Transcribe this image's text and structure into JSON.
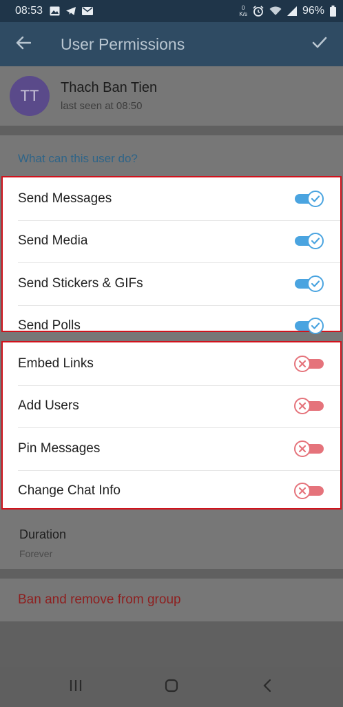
{
  "status_bar": {
    "time": "08:53",
    "net_speed_value": "0",
    "net_speed_unit": "K/s",
    "battery": "96%",
    "icons": [
      "gallery-icon",
      "telegram-icon",
      "mail-icon",
      "alarm-icon",
      "wifi-icon",
      "signal-icon",
      "battery-icon"
    ]
  },
  "app_bar": {
    "title": "User Permissions",
    "back_icon": "back-arrow-icon",
    "confirm_icon": "checkmark-icon"
  },
  "user": {
    "initials": "TT",
    "name": "Thach Ban Tien",
    "last_seen": "last seen at 08:50"
  },
  "permissions": {
    "header": "What can this user do?",
    "allowed": [
      {
        "label": "Send Messages",
        "enabled": true
      },
      {
        "label": "Send Media",
        "enabled": true
      },
      {
        "label": "Send Stickers & GIFs",
        "enabled": true
      },
      {
        "label": "Send Polls",
        "enabled": true
      }
    ],
    "denied": [
      {
        "label": "Embed Links",
        "enabled": false
      },
      {
        "label": "Add Users",
        "enabled": false
      },
      {
        "label": "Pin Messages",
        "enabled": false
      },
      {
        "label": "Change Chat Info",
        "enabled": false
      }
    ]
  },
  "duration": {
    "title": "Duration",
    "value": "Forever"
  },
  "ban": {
    "label": "Ban and remove from group"
  },
  "nav_bar": {
    "icons": [
      "recent-apps-icon",
      "home-icon",
      "back-nav-icon"
    ]
  },
  "colors": {
    "app_bar": "#2f4b63",
    "status_bar": "#1f3549",
    "toggle_on": "#4aa4e0",
    "toggle_off": "#e5737b",
    "highlight_border": "#d0121c",
    "ban_text": "#8e1f1f",
    "section_header": "#2e6488"
  }
}
